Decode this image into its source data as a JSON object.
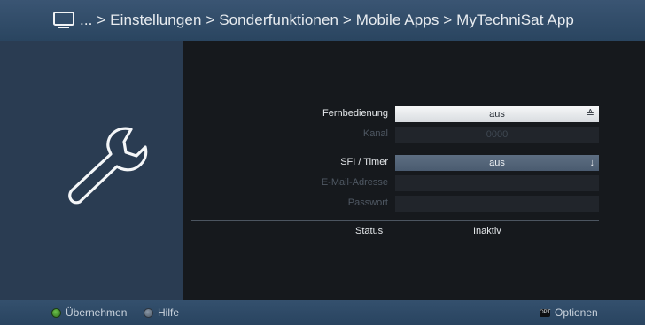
{
  "header": {
    "breadcrumb": "... > Einstellungen > Sonderfunktionen > Mobile Apps > MyTechniSat App",
    "icon": "tv-icon"
  },
  "sidepanel": {
    "icon": "wrench-icon"
  },
  "settings": {
    "fernbedienung": {
      "label": "Fernbedienung",
      "value": "aus",
      "control": "≙"
    },
    "kanal": {
      "label": "Kanal",
      "value": "0000"
    },
    "sfi_timer": {
      "label": "SFI / Timer",
      "value": "aus",
      "control": "↓"
    },
    "email": {
      "label": "E-Mail-Adresse",
      "value": ""
    },
    "passwort": {
      "label": "Passwort",
      "value": ""
    }
  },
  "status": {
    "label": "Status",
    "value": "Inaktiv"
  },
  "footer": {
    "uebernehmen": "Übernehmen",
    "hilfe": "Hilfe",
    "opt_badge": "OPT",
    "optionen": "Optionen"
  },
  "colors": {
    "header": "#3a5573",
    "sidepanel": "#2a3c52",
    "background": "#16191d",
    "selected_field": "#f6f7f8",
    "standard_field": "#5d6e82"
  }
}
